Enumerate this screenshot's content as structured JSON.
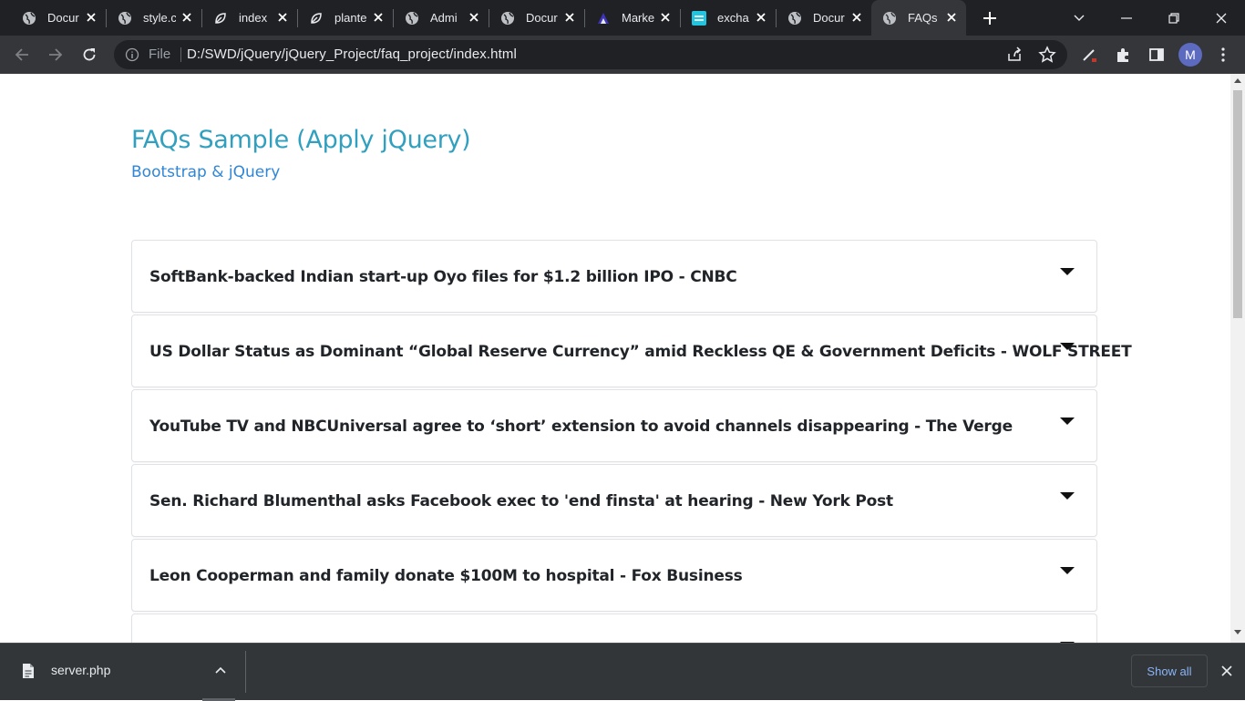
{
  "browser": {
    "tabs": [
      {
        "title": "Docur",
        "icon": "globe-icon"
      },
      {
        "title": "style.c",
        "icon": "globe-icon"
      },
      {
        "title": "index",
        "icon": "leaf-icon"
      },
      {
        "title": "plante",
        "icon": "leaf-icon"
      },
      {
        "title": "Admi",
        "icon": "globe-icon"
      },
      {
        "title": "Docur",
        "icon": "globe-icon"
      },
      {
        "title": "Marke",
        "icon": "market-icon"
      },
      {
        "title": "excha",
        "icon": "exchange-icon"
      },
      {
        "title": "Docur",
        "icon": "globe-icon"
      },
      {
        "title": "FAQs",
        "icon": "globe-icon",
        "active": true
      }
    ],
    "address": {
      "scheme_label": "File",
      "url": "D:/SWD/jQuery/jQuery_Project/faq_project/index.html"
    },
    "profile_initial": "M"
  },
  "page": {
    "title": "FAQs Sample (Apply jQuery)",
    "subtitle": "Bootstrap & jQuery",
    "faqs": [
      {
        "question": "SoftBank-backed Indian start-up Oyo files for $1.2 billion IPO - CNBC"
      },
      {
        "question": "US Dollar Status as Dominant “Global Reserve Currency” amid Reckless QE & Government Deficits - WOLF STREET"
      },
      {
        "question": "YouTube TV and NBCUniversal agree to ‘short’ extension to avoid channels disappearing - The Verge"
      },
      {
        "question": "Sen. Richard Blumenthal asks Facebook exec to 'end finsta' at hearing - New York Post"
      },
      {
        "question": "Leon Cooperman and family donate $100M to hospital - Fox Business"
      },
      {
        "question": ""
      }
    ]
  },
  "downloads": {
    "file_name": "server.php",
    "show_all_label": "Show all"
  },
  "colors": {
    "title": "#31a0bf",
    "subtitle": "#2f86d6",
    "link": "#8ab4f8"
  }
}
